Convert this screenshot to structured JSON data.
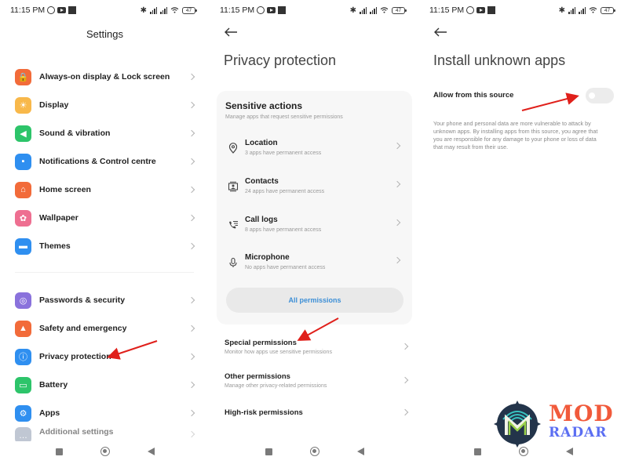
{
  "status_bar": {
    "time": "11:15 PM",
    "battery": "47",
    "icons": [
      "alarm-icon",
      "youtube-icon",
      "notification-square-icon",
      "bluetooth-icon",
      "signal-icon",
      "signal-icon",
      "wifi-icon",
      "battery-icon"
    ]
  },
  "screen1": {
    "title": "Settings",
    "group1": [
      {
        "label": "Always-on display & Lock screen",
        "icon": "lock-icon",
        "color": "#f26b3a",
        "glyph": "🔒"
      },
      {
        "label": "Display",
        "icon": "sun-icon",
        "color": "#f8b84a",
        "glyph": "☀"
      },
      {
        "label": "Sound & vibration",
        "icon": "speaker-icon",
        "color": "#2dc46a",
        "glyph": "◀"
      },
      {
        "label": "Notifications & Control centre",
        "icon": "notification-icon",
        "color": "#2f8ff0",
        "glyph": "▪"
      },
      {
        "label": "Home screen",
        "icon": "home-icon",
        "color": "#f26b3a",
        "glyph": "⌂"
      },
      {
        "label": "Wallpaper",
        "icon": "wallpaper-icon",
        "color": "#ee6f91",
        "glyph": "✿"
      },
      {
        "label": "Themes",
        "icon": "themes-icon",
        "color": "#2f8ff0",
        "glyph": "▬"
      }
    ],
    "group2": [
      {
        "label": "Passwords & security",
        "icon": "fingerprint-icon",
        "color": "#8a72dc",
        "glyph": "◎"
      },
      {
        "label": "Safety and emergency",
        "icon": "emergency-icon",
        "color": "#f26b3a",
        "glyph": "▲"
      },
      {
        "label": "Privacy protection",
        "icon": "privacy-icon",
        "color": "#2f8ff0",
        "glyph": "ⓘ"
      },
      {
        "label": "Battery",
        "icon": "battery-setting-icon",
        "color": "#2dc46a",
        "glyph": "▭"
      },
      {
        "label": "Apps",
        "icon": "apps-gear-icon",
        "color": "#2f8ff0",
        "glyph": "⚙"
      },
      {
        "label": "Additional settings",
        "icon": "additional-settings-icon",
        "color": "#8e9bb0",
        "glyph": "…"
      }
    ]
  },
  "screen2": {
    "title": "Privacy protection",
    "card": {
      "title": "Sensitive actions",
      "subtitle": "Manage apps that request sensitive permissions",
      "items": [
        {
          "title": "Location",
          "subtitle": "3 apps have permanent access",
          "icon": "location-pin-icon"
        },
        {
          "title": "Contacts",
          "subtitle": "24 apps have permanent access",
          "icon": "contacts-icon"
        },
        {
          "title": "Call logs",
          "subtitle": "8 apps have permanent access",
          "icon": "call-logs-icon"
        },
        {
          "title": "Microphone",
          "subtitle": "No apps have permanent access",
          "icon": "microphone-icon"
        }
      ],
      "all_permissions_label": "All permissions"
    },
    "rows": [
      {
        "title": "Special permissions",
        "subtitle": "Monitor how apps use sensitive permissions"
      },
      {
        "title": "Other permissions",
        "subtitle": "Manage other privacy-related permissions"
      },
      {
        "title": "High-risk permissions",
        "subtitle": ""
      }
    ]
  },
  "screen3": {
    "title": "Install unknown apps",
    "allow_label": "Allow from this source",
    "allow_enabled": false,
    "warning": "Your phone and personal data are more vulnerable to attack by unknown apps. By installing apps from this source, you agree that you are responsible for any damage to your phone or loss of data that may result from their use."
  },
  "watermark": {
    "line1": "MOD",
    "line2": "RADAR",
    "color1": "#f15a3b",
    "color2": "#5b6ef2"
  },
  "annotation_color": "#e0201b"
}
